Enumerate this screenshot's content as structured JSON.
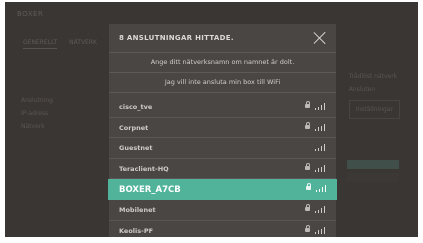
{
  "background": {
    "header": "BOXER",
    "tabs": [
      "GENERELLT",
      "NÄTVERK"
    ],
    "lines": [
      "Anslutning",
      "IP-adress",
      "Nätverk"
    ],
    "right_lines": [
      "Trådlöst nätverk",
      "Ansluten",
      "Inställningar"
    ]
  },
  "modal": {
    "title": "8 ANSLUTNINGAR HITTADE.",
    "close_icon": "close-icon",
    "enter_name_label": "Ange ditt nätverksnamn om namnet är dolt.",
    "no_wifi_label": "Jag vill inte ansluta min box till WiFi"
  },
  "networks": [
    {
      "name": "cisco_tve",
      "locked": true,
      "selected": false
    },
    {
      "name": "Corpnet",
      "locked": true,
      "selected": false
    },
    {
      "name": "Guestnet",
      "locked": false,
      "selected": false
    },
    {
      "name": "Teraclient-HQ",
      "locked": true,
      "selected": false
    },
    {
      "name": "BOXER_A7CB",
      "locked": true,
      "selected": true
    },
    {
      "name": "Mobilenet",
      "locked": true,
      "selected": false
    },
    {
      "name": "Keolis-PF",
      "locked": true,
      "selected": false
    }
  ],
  "colors": {
    "accent": "#52b39b",
    "modal_bg": "#4a4644",
    "screen_bg": "#3a3634"
  }
}
